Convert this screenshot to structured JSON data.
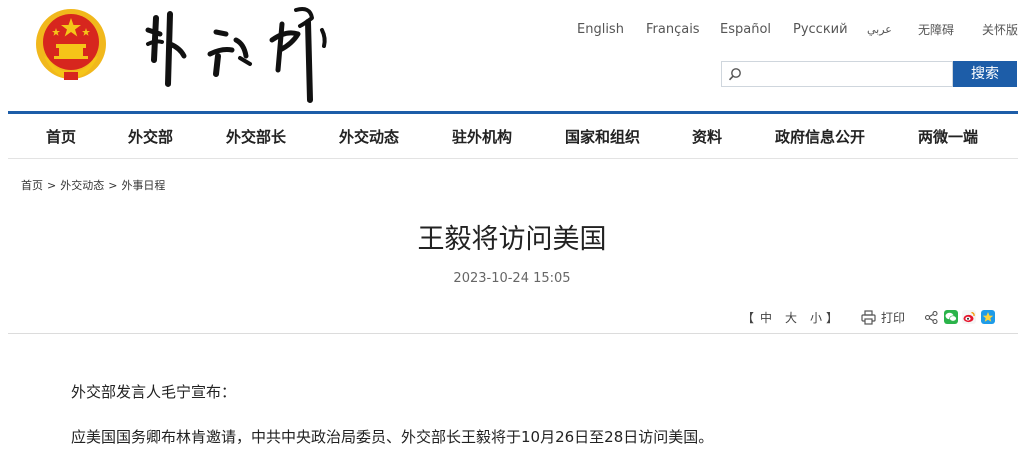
{
  "header": {
    "languages": [
      "English",
      "Français",
      "Español",
      "Русский",
      "عربي",
      "无障碍",
      "关怀版"
    ],
    "search": {
      "placeholder": "",
      "button_label": "搜索"
    }
  },
  "nav": {
    "items": [
      "首页",
      "外交部",
      "外交部长",
      "外交动态",
      "驻外机构",
      "国家和组织",
      "资料",
      "政府信息公开",
      "两微一端"
    ]
  },
  "breadcrumb": [
    "首页",
    "外交动态",
    "外事日程"
  ],
  "article": {
    "title": "王毅将访问美国",
    "datetime": "2023-10-24 15:05",
    "font_size": {
      "open": "【",
      "large": "中",
      "medium": "大",
      "small": "小",
      "close": "】"
    },
    "print_label": "打印",
    "paragraphs": [
      "外交部发言人毛宁宣布：",
      "应美国国务卿布林肯邀请，中共中央政治局委员、外交部长王毅将于10月26日至28日访问美国。"
    ]
  },
  "colors": {
    "accent": "#1d5da8",
    "emblem_red": "#d7261e",
    "emblem_gold": "#f5c518"
  }
}
